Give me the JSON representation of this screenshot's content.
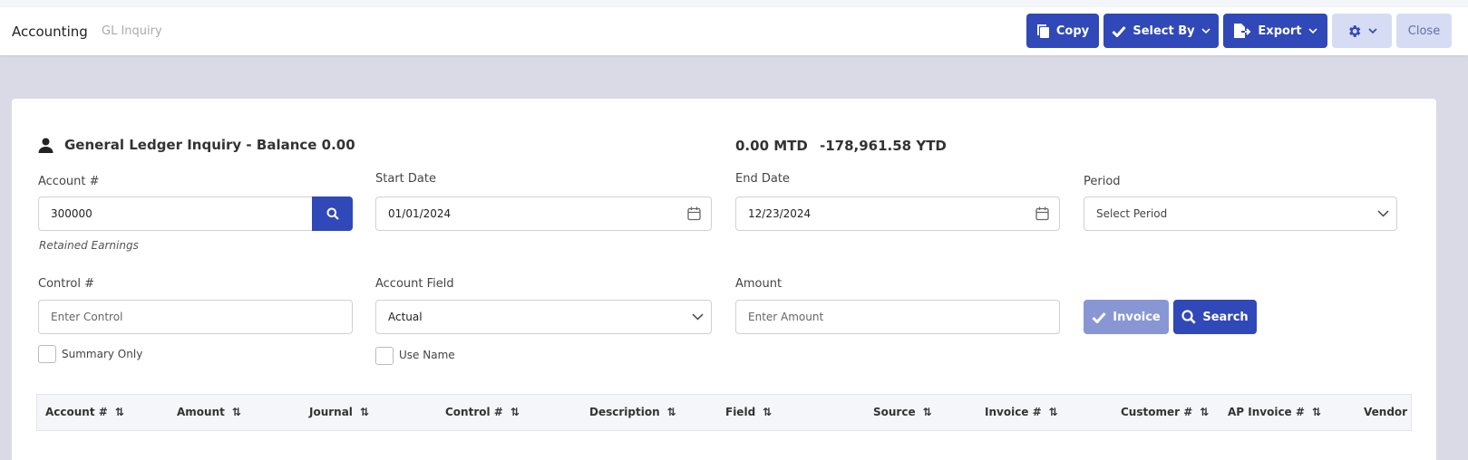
{
  "header": {
    "breadcrumb_main": "Accounting",
    "breadcrumb_sub": "GL Inquiry",
    "buttons": {
      "copy": "Copy",
      "select_by": "Select By",
      "export": "Export",
      "close": "Close"
    }
  },
  "form": {
    "title": "General Ledger Inquiry - Balance 0.00",
    "mtd": "0.00 MTD",
    "ytd": "-178,961.58 YTD",
    "account": {
      "label": "Account #",
      "value": "300000",
      "hint": "Retained Earnings"
    },
    "start_date": {
      "label": "Start Date",
      "value": "01/01/2024"
    },
    "end_date": {
      "label": "End Date",
      "value": "12/23/2024"
    },
    "period": {
      "label": "Period",
      "value": "Select Period"
    },
    "control": {
      "label": "Control #",
      "placeholder": "Enter Control"
    },
    "account_field": {
      "label": "Account Field",
      "value": "Actual"
    },
    "amount": {
      "label": "Amount",
      "placeholder": "Enter Amount"
    },
    "summary_only": "Summary Only",
    "use_name": "Use Name",
    "invoice_button": "Invoice",
    "search_button": "Search"
  },
  "table": {
    "columns": [
      "Account #",
      "Amount",
      "Journal",
      "Control #",
      "Description",
      "Field",
      "Source",
      "Invoice #",
      "Customer #",
      "AP Invoice #",
      "Vendor #"
    ]
  },
  "colors": {
    "primary": "#3048b8",
    "primary_light": "#8897d4",
    "gear_bg": "#d6dcf3",
    "page_bg": "#d9dae6"
  }
}
